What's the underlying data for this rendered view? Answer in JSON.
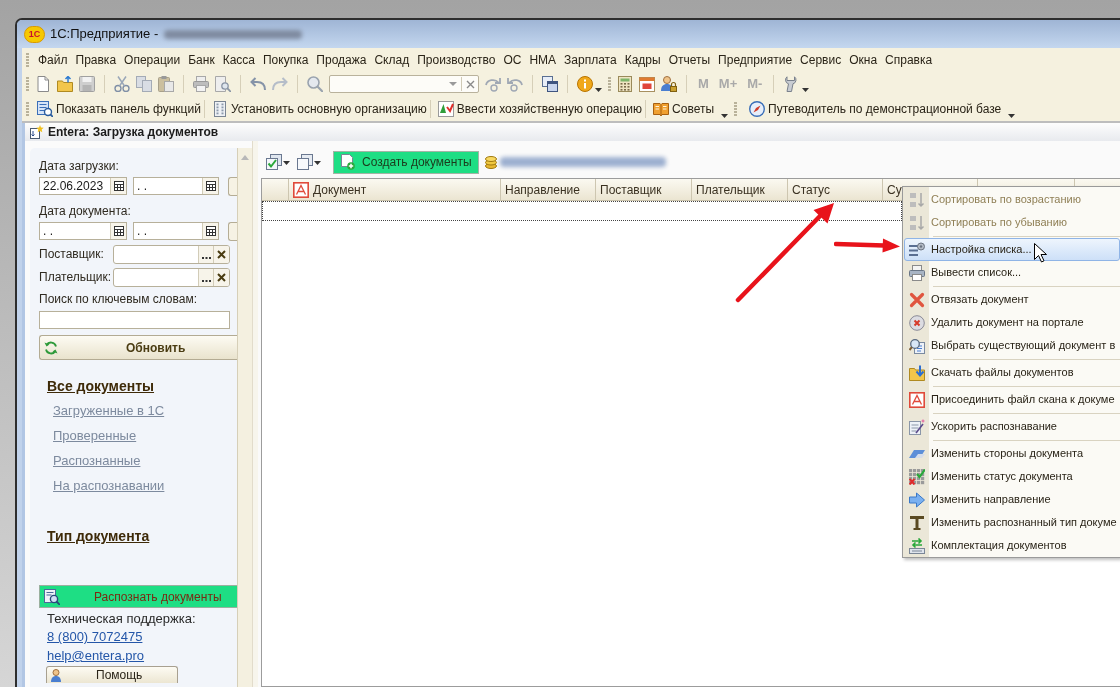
{
  "window": {
    "logo": "1С",
    "title": "1С:Предприятие -"
  },
  "menu_bar": [
    "Файл",
    "Правка",
    "Операции",
    "Банк",
    "Касса",
    "Покупка",
    "Продажа",
    "Склад",
    "Производство",
    "ОС",
    "НМА",
    "Зарплата",
    "Кадры",
    "Отчеты",
    "Предприятие",
    "Сервис",
    "Окна",
    "Справка"
  ],
  "toolbar": {
    "memory_buttons": [
      {
        "label": "M",
        "disabled": true
      },
      {
        "label": "M+",
        "disabled": true
      },
      {
        "label": "M-",
        "disabled": true
      }
    ]
  },
  "quick_toolbar": [
    {
      "label": "Показать панель функций",
      "dropdown": false
    },
    {
      "label": "Установить основную организацию",
      "dropdown": false
    },
    {
      "label": "Ввести хозяйственную операцию",
      "dropdown": false
    },
    {
      "label": "Советы",
      "dropdown": true
    },
    {
      "label": "Путеводитель по демонстрационной базе",
      "dropdown": true
    }
  ],
  "document_window": {
    "title": "Entera: Загрузка документов"
  },
  "filters": {
    "upload_date": {
      "label": "Дата загрузки:",
      "from": "22.06.2023",
      "to": ". ."
    },
    "document_date": {
      "label": "Дата документа:",
      "from": ". .",
      "to": ". ."
    },
    "supplier": {
      "label": "Поставщик:"
    },
    "payer": {
      "label": "Плательщик:"
    },
    "keyword_search": {
      "label": "Поиск по ключевым словам:"
    }
  },
  "refresh_button": "Обновить",
  "sections": [
    {
      "title": "Все документы",
      "links": [
        "Загруженные в 1С",
        "Проверенные",
        "Распознанные",
        "На распознавании"
      ]
    },
    {
      "title": "Тип документа"
    }
  ],
  "recognize_button": "Распознать документы",
  "support": {
    "label": "Техническая поддержка:",
    "phone": "8 (800) 7072475",
    "email": "help@entera.pro"
  },
  "help_button": "Помощь",
  "main_toolbar": {
    "create_button": "Создать документы"
  },
  "table": {
    "columns": [
      "Документ",
      "Направление",
      "Поставщик",
      "Плательщик",
      "Статус",
      "Су"
    ]
  },
  "context_menu": {
    "groups": [
      {
        "items": [
          {
            "label": "Сортировать по возрастанию",
            "disabled": true,
            "selected": false
          },
          {
            "label": "Сортировать по убыванию",
            "disabled": true,
            "selected": false
          }
        ]
      },
      {
        "items": [
          {
            "label": "Настройка списка...",
            "disabled": false,
            "selected": true
          },
          {
            "label": "Вывести список...",
            "disabled": false,
            "selected": false
          }
        ]
      },
      {
        "items": [
          {
            "label": "Отвязать документ",
            "disabled": false,
            "selected": false
          },
          {
            "label": "Удалить документ на портале",
            "disabled": false,
            "selected": false
          },
          {
            "label": "Выбрать существующий документ в",
            "disabled": false,
            "selected": false
          }
        ]
      },
      {
        "items": [
          {
            "label": "Скачать файлы документов",
            "disabled": false,
            "selected": false
          }
        ]
      },
      {
        "items": [
          {
            "label": "Присоединить файл скана к докуме",
            "disabled": false,
            "selected": false
          }
        ]
      },
      {
        "items": [
          {
            "label": "Ускорить распознавание",
            "disabled": false,
            "selected": false
          }
        ]
      },
      {
        "items": [
          {
            "label": "Изменить стороны документа",
            "disabled": false,
            "selected": false
          },
          {
            "label": "Изменить статус документа",
            "disabled": false,
            "selected": false
          },
          {
            "label": "Изменить направление",
            "disabled": false,
            "selected": false
          },
          {
            "label": "Изменить распознанный тип докуме",
            "disabled": false,
            "selected": false
          },
          {
            "label": "Комплектация документов",
            "disabled": false,
            "selected": false
          }
        ]
      }
    ]
  }
}
